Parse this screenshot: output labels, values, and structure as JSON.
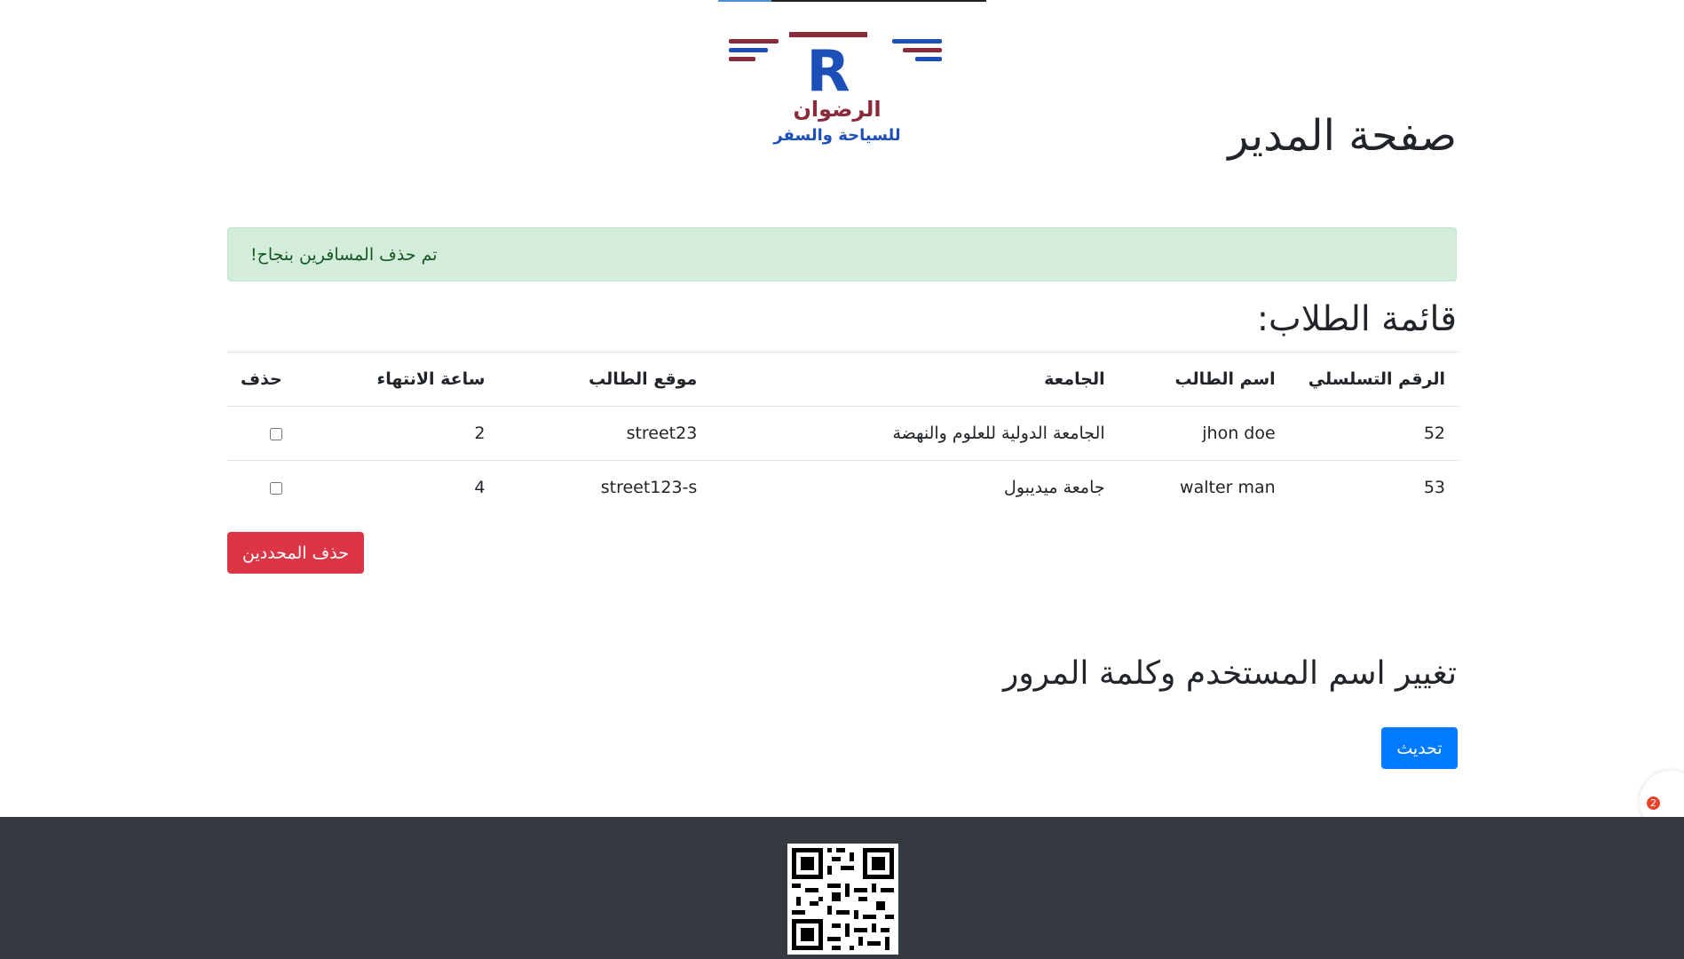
{
  "brand": {
    "logo_letter": "R",
    "logo_name": "الرضوان",
    "logo_tagline": "للسياحة والسفر",
    "colors": {
      "maroon": "#8b2a3b",
      "blue": "#1d4fb8"
    }
  },
  "page": {
    "title": "صفحة المدير"
  },
  "alert": {
    "message": "تم حذف المسافرين بنجاح!",
    "color": "#d4edda"
  },
  "students": {
    "title": "قائمة الطلاب:",
    "columns": [
      "الرقم التسلسلي",
      "اسم الطالب",
      "الجامعة",
      "موقع الطالب",
      "ساعة الانتهاء",
      "حذف"
    ],
    "rows": [
      {
        "id": "52",
        "name": "jhon doe",
        "university": "الجامعة الدولية للعلوم والنهضة",
        "location": "street23",
        "end_hour": "2",
        "selected": false
      },
      {
        "id": "53",
        "name": "walter man",
        "university": "جامعة ميديبول",
        "location": "street123-s",
        "end_hour": "4",
        "selected": false
      }
    ],
    "delete_selected_label": "حذف المحددين"
  },
  "account": {
    "title": "تغيير اسم المستخدم وكلمة المرور",
    "update_label": "تحديث"
  },
  "chat": {
    "badge_count": "2"
  },
  "footer": {
    "qr_icon": "qr-code-icon",
    "background": "#343a40"
  }
}
